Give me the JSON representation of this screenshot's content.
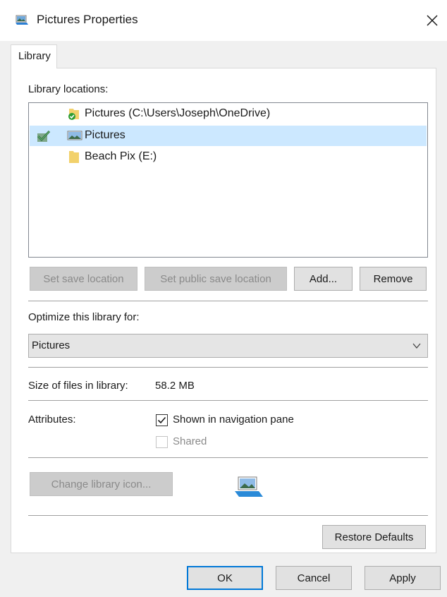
{
  "window": {
    "title": "Pictures Properties",
    "close_icon": "close-icon",
    "title_icon": "library-pictures-icon"
  },
  "tabs": [
    {
      "label": "Library",
      "active": true
    }
  ],
  "locations": {
    "label": "Library locations:",
    "items": [
      {
        "label": "Pictures (C:\\Users\\Joseph\\OneDrive)",
        "icon": "onedrive-folder-icon",
        "selected": false,
        "default_save": false
      },
      {
        "label": "Pictures",
        "icon": "pictures-folder-icon",
        "selected": true,
        "default_save": true
      },
      {
        "label": "Beach Pix (E:)",
        "icon": "folder-icon",
        "selected": false,
        "default_save": false
      }
    ]
  },
  "buttons": {
    "set_save": "Set save location",
    "set_public_save": "Set public save location",
    "add": "Add...",
    "remove": "Remove",
    "change_icon": "Change library icon...",
    "restore": "Restore Defaults",
    "ok": "OK",
    "cancel": "Cancel",
    "apply": "Apply"
  },
  "optimize": {
    "label": "Optimize this library for:",
    "value": "Pictures"
  },
  "size": {
    "label": "Size of files in library:",
    "value": "58.2 MB"
  },
  "attributes": {
    "label": "Attributes:",
    "shown_in_nav": {
      "label": "Shown in navigation pane",
      "checked": true
    },
    "shared": {
      "label": "Shared",
      "checked": false,
      "disabled": true
    }
  },
  "colors": {
    "accent": "#0078d7",
    "selection": "#cce8ff"
  }
}
